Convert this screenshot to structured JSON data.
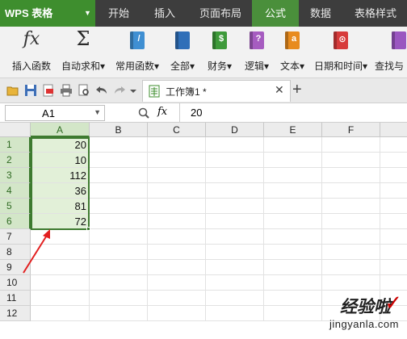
{
  "app": {
    "title": "WPS 表格"
  },
  "tabs": [
    "开始",
    "插入",
    "页面布局",
    "公式",
    "数据",
    "表格样式"
  ],
  "active_tab": "公式",
  "ribbon": {
    "buttons": [
      {
        "label": "插入函数",
        "icon": "fx-icon"
      },
      {
        "label": "自动求和",
        "icon": "sigma-icon",
        "caret": "▾"
      },
      {
        "label": "常用函数",
        "icon": "function-book-icon",
        "caret": "▾"
      },
      {
        "label": "全部",
        "icon": "all-functions-icon",
        "caret": "▾"
      },
      {
        "label": "财务",
        "icon": "finance-icon",
        "caret": "▾"
      },
      {
        "label": "逻辑",
        "icon": "logic-icon",
        "caret": "▾"
      },
      {
        "label": "文本",
        "icon": "text-func-icon",
        "caret": "▾"
      },
      {
        "label": "日期和时间",
        "icon": "datetime-icon",
        "caret": "▾"
      },
      {
        "label": "查找与",
        "icon": "lookup-icon"
      }
    ],
    "glyphs": {
      "fx": "fx",
      "sigma": "Σ",
      "book1": "/",
      "finance": "$",
      "logic": "?",
      "text": "a",
      "date": "⊙"
    }
  },
  "document": {
    "tab_title": "工作簿1 *",
    "close": "✕",
    "new_tab": "+"
  },
  "formula_bar": {
    "cell_ref": "A1",
    "fx": "fx",
    "value": "20"
  },
  "grid": {
    "columns": [
      "A",
      "B",
      "C",
      "D",
      "E",
      "F"
    ],
    "rows": [
      "1",
      "2",
      "3",
      "4",
      "5",
      "6",
      "7",
      "8",
      "9",
      "10",
      "11",
      "12"
    ],
    "column_a_values": [
      "20",
      "10",
      "112",
      "36",
      "81",
      "72"
    ]
  },
  "watermark": {
    "line1": "经验啦",
    "line2": "jingyanla.com",
    "check": "✓"
  },
  "colors": {
    "accent": "#3e8e2e",
    "selection": "#3d7a2f",
    "arrow": "#e21f1f"
  }
}
